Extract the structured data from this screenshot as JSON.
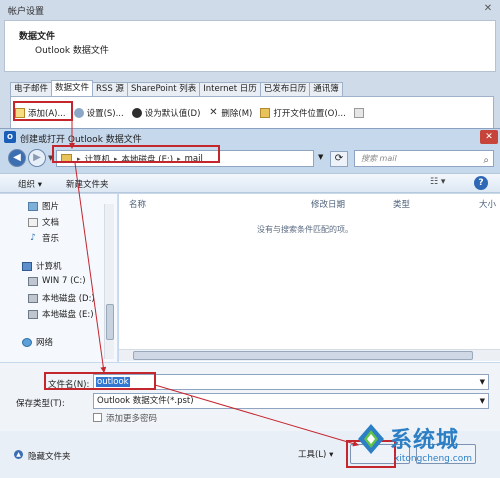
{
  "account_window": {
    "title": "帐户设置",
    "close_glyph": "✕",
    "heading": "数据文件",
    "subheading": "Outlook 数据文件",
    "tabs": [
      "电子邮件",
      "数据文件",
      "RSS 源",
      "SharePoint 列表",
      "Internet 日历",
      "已发布日历",
      "通讯簿"
    ],
    "toolbar": {
      "add": "添加(A)...",
      "settings": "设置(S)...",
      "set_default": "设为默认值(D)",
      "remove": "删除(M)",
      "open_folder": "打开文件位置(O)..."
    }
  },
  "dialog": {
    "app_icon_label": "O",
    "title": "创建或打开 Outlook 数据文件",
    "close_glyph": "✕",
    "breadcrumb": [
      "计算机",
      "本地磁盘 (E:)",
      "mail"
    ],
    "search_placeholder": "搜索 mail",
    "commands": {
      "organize": "组织 ▾",
      "new_folder": "新建文件夹",
      "view_glyph": "☷ ▾",
      "help_glyph": "?"
    },
    "nav": {
      "items": [
        {
          "label": "图片",
          "icon": "pictures-icon"
        },
        {
          "label": "文档",
          "icon": "documents-icon"
        },
        {
          "label": "音乐",
          "icon": "music-icon"
        },
        {
          "label": "计算机",
          "icon": "computer-icon"
        },
        {
          "label": "WIN 7 (C:)",
          "icon": "drive-icon"
        },
        {
          "label": "本地磁盘 (D:)",
          "icon": "drive-icon"
        },
        {
          "label": "本地磁盘 (E:)",
          "icon": "drive-icon"
        },
        {
          "label": "网络",
          "icon": "network-icon"
        }
      ]
    },
    "columns": [
      "名称",
      "修改日期",
      "类型",
      "大小"
    ],
    "empty_message": "没有与搜索条件匹配的项。",
    "form": {
      "filename_label": "文件名(N):",
      "filename_value": "outlook",
      "type_label": "保存类型(T):",
      "type_value": "Outlook 数据文件(*.pst)",
      "checkbox_label": "添加更多密码"
    },
    "footer": {
      "hide_folders": "隐藏文件夹",
      "tools": "工具(L) ▾"
    }
  },
  "watermark": {
    "brand": "系统城",
    "url": "xitongcheng.com"
  },
  "colors": {
    "accent": "#3278d2",
    "annotation_red": "#c4262e"
  }
}
